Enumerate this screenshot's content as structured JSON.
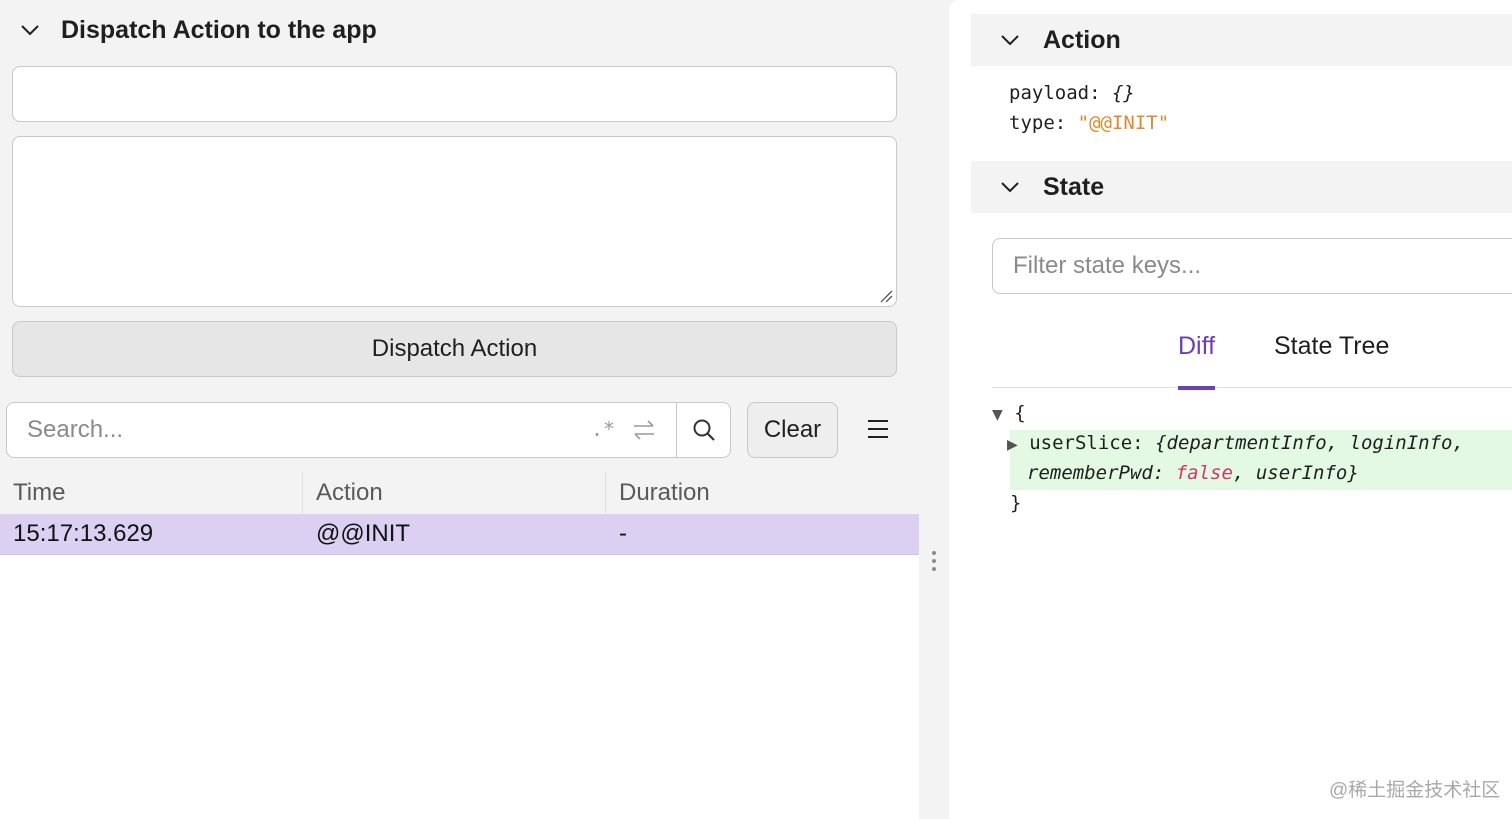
{
  "dispatch": {
    "title": "Dispatch Action to the app",
    "type_value": "",
    "payload_value": "",
    "button_label": "Dispatch Action"
  },
  "log": {
    "search_placeholder": "Search...",
    "regex_glyph": ".*",
    "clear_label": "Clear",
    "columns": [
      "Time",
      "Action",
      "Duration"
    ],
    "rows": [
      {
        "time": "15:17:13.629",
        "action": "@@INIT",
        "duration": "-"
      }
    ]
  },
  "inspector": {
    "action_title": "Action",
    "action_lines": {
      "payload_key": "payload:",
      "payload_value": "{}",
      "type_key": "type:",
      "type_value": "\"@@INIT\""
    },
    "state_title": "State",
    "filter_placeholder": "Filter state keys...",
    "tabs": [
      "Diff",
      "State Tree"
    ],
    "active_tab": "Diff",
    "tree": {
      "open_brace": "{",
      "key": "userSlice:",
      "value_part1": "{departmentInfo, loginInfo,",
      "value_part2_key": "rememberPwd:",
      "value_part2_bool": "false",
      "value_part2_end": ", userInfo}",
      "close_brace": "}"
    }
  },
  "watermark": "@稀土掘金技术社区",
  "colors": {
    "accent": "#6a3fc1",
    "selected_row": "#dcd0f2",
    "string": "#e0892c",
    "boolean": "#d6336c",
    "diff_added": "#e3f9e3"
  }
}
